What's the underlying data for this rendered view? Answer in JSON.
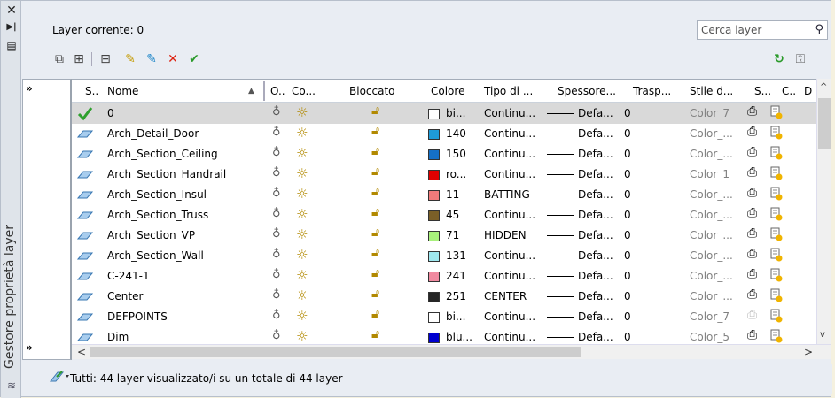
{
  "current_layer": "Layer corrente: 0",
  "search": {
    "placeholder": "Cerca layer"
  },
  "palette_title": "Gestore proprietà layer",
  "headers": {
    "status": "S..",
    "name": "Nome",
    "on": "O..",
    "freeze": "Co...",
    "lock": "Bloccato",
    "color": "Colore",
    "linetype": "Tipo di ...",
    "lineweight": "Spessore...",
    "transparency": "Trasp...",
    "plotstyle": "Stile d...",
    "plot": "S...",
    "vpfreeze": "C..",
    "desc": "D"
  },
  "layers": [
    {
      "name": "0",
      "color": "#ffffff",
      "colorLabel": "bi...",
      "linetype": "Continu...",
      "lineweight": "Defa...",
      "transparency": "0",
      "plotstyle": "Color_7",
      "current": true,
      "plotDim": false
    },
    {
      "name": "Arch_Detail_Door",
      "color": "#1e9bd9",
      "colorLabel": "140",
      "linetype": "Continu...",
      "lineweight": "Defa...",
      "transparency": "0",
      "plotstyle": "Color_...",
      "current": false,
      "plotDim": false
    },
    {
      "name": "Arch_Section_Ceiling",
      "color": "#1570c6",
      "colorLabel": "150",
      "linetype": "Continu...",
      "lineweight": "Defa...",
      "transparency": "0",
      "plotstyle": "Color_...",
      "current": false,
      "plotDim": false
    },
    {
      "name": "Arch_Section_Handrail",
      "color": "#e00000",
      "colorLabel": "ro...",
      "linetype": "Continu...",
      "lineweight": "Defa...",
      "transparency": "0",
      "plotstyle": "Color_1",
      "current": false,
      "plotDim": false
    },
    {
      "name": "Arch_Section_Insul",
      "color": "#f07a7a",
      "colorLabel": "11",
      "linetype": "BATTING",
      "lineweight": "Defa...",
      "transparency": "0",
      "plotstyle": "Color_...",
      "current": false,
      "plotDim": false
    },
    {
      "name": "Arch_Section_Truss",
      "color": "#7a5f28",
      "colorLabel": "45",
      "linetype": "Continu...",
      "lineweight": "Defa...",
      "transparency": "0",
      "plotstyle": "Color_...",
      "current": false,
      "plotDim": false
    },
    {
      "name": "Arch_Section_VP",
      "color": "#a8f07c",
      "colorLabel": "71",
      "linetype": "HIDDEN",
      "lineweight": "Defa...",
      "transparency": "0",
      "plotstyle": "Color_...",
      "current": false,
      "plotDim": false
    },
    {
      "name": "Arch_Section_Wall",
      "color": "#9fe8ef",
      "colorLabel": "131",
      "linetype": "Continu...",
      "lineweight": "Defa...",
      "transparency": "0",
      "plotstyle": "Color_...",
      "current": false,
      "plotDim": false
    },
    {
      "name": "C-241-1",
      "color": "#f08aa0",
      "colorLabel": "241",
      "linetype": "Continu...",
      "lineweight": "Defa...",
      "transparency": "0",
      "plotstyle": "Color_...",
      "current": false,
      "plotDim": false
    },
    {
      "name": "Center",
      "color": "#262626",
      "colorLabel": "251",
      "linetype": "CENTER",
      "lineweight": "Defa...",
      "transparency": "0",
      "plotstyle": "Color_...",
      "current": false,
      "plotDim": false
    },
    {
      "name": "DEFPOINTS",
      "color": "#ffffff",
      "colorLabel": "bi...",
      "linetype": "Continu...",
      "lineweight": "Defa...",
      "transparency": "0",
      "plotstyle": "Color_7",
      "current": false,
      "plotDim": true
    },
    {
      "name": "Dim",
      "color": "#0000d0",
      "colorLabel": "blu...",
      "linetype": "Continu...",
      "lineweight": "Defa...",
      "transparency": "0",
      "plotstyle": "Color_5",
      "current": false,
      "plotDim": false
    }
  ],
  "status_text": "Tutti: 44 layer visualizzato/i su un totale di 44 layer",
  "icons": {
    "close": "close-icon",
    "autohide": "autohide-icon",
    "props": "properties-icon",
    "search": "search-icon",
    "refresh": "refresh-icon",
    "settings": "settings-icon"
  }
}
